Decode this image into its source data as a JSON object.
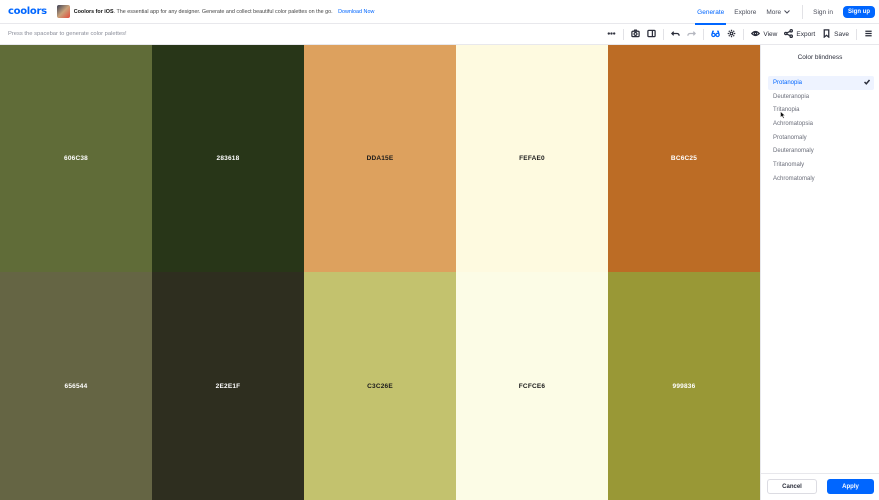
{
  "brand": {
    "logo": "coolors"
  },
  "promo": {
    "title": "Coolors for iOS",
    "text": "The essential app for any designer. Generate and collect beautiful color palettes on the go.",
    "link": "Download Now"
  },
  "nav": {
    "generate": "Generate",
    "explore": "Explore",
    "more": "More",
    "signin": "Sign in",
    "signup": "Sign up"
  },
  "toolbar": {
    "hint": "Press the spacebar to generate color palettes!",
    "view": "View",
    "export": "Export",
    "save": "Save"
  },
  "palette": {
    "top": [
      {
        "hex": "606C38",
        "color": "#606c38",
        "text_color": "#ffffff"
      },
      {
        "hex": "283618",
        "color": "#283618",
        "text_color": "#ffffff"
      },
      {
        "hex": "DDA15E",
        "color": "#dda15e",
        "text_color": "#1a1a1a"
      },
      {
        "hex": "FEFAE0",
        "color": "#fefae0",
        "text_color": "#1a1a1a"
      },
      {
        "hex": "BC6C25",
        "color": "#bc6c25",
        "text_color": "#ffffff"
      }
    ],
    "bottom": [
      {
        "hex": "656544",
        "color": "#656544",
        "text_color": "#ffffff"
      },
      {
        "hex": "2E2E1F",
        "color": "#2e2e1f",
        "text_color": "#ffffff"
      },
      {
        "hex": "C3C26E",
        "color": "#c3c26e",
        "text_color": "#1a1a1a"
      },
      {
        "hex": "FCFCE6",
        "color": "#fcfce6",
        "text_color": "#1a1a1a"
      },
      {
        "hex": "999836",
        "color": "#999836",
        "text_color": "#ffffff"
      }
    ]
  },
  "sidebar": {
    "title": "Color blindness",
    "items": [
      {
        "label": "Protanopia",
        "selected": true
      },
      {
        "label": "Deuteranopia",
        "selected": false
      },
      {
        "label": "Tritanopia",
        "selected": false
      },
      {
        "label": "Achromatopsia",
        "selected": false
      },
      {
        "label": "Protanomaly",
        "selected": false
      },
      {
        "label": "Deuteranomaly",
        "selected": false
      },
      {
        "label": "Tritanomaly",
        "selected": false
      },
      {
        "label": "Achromatomaly",
        "selected": false
      }
    ],
    "cancel": "Cancel",
    "apply": "Apply"
  },
  "colors": {
    "accent": "#0066ff",
    "selected_bg": "#eef3ff"
  },
  "icons": [
    "more-icon",
    "camera-icon",
    "sidebar-icon",
    "undo-icon",
    "redo-icon",
    "glasses-icon",
    "settings-icon",
    "eye-icon",
    "share-icon",
    "bookmark-icon",
    "menu-icon",
    "check-icon",
    "chevron-down-icon"
  ]
}
